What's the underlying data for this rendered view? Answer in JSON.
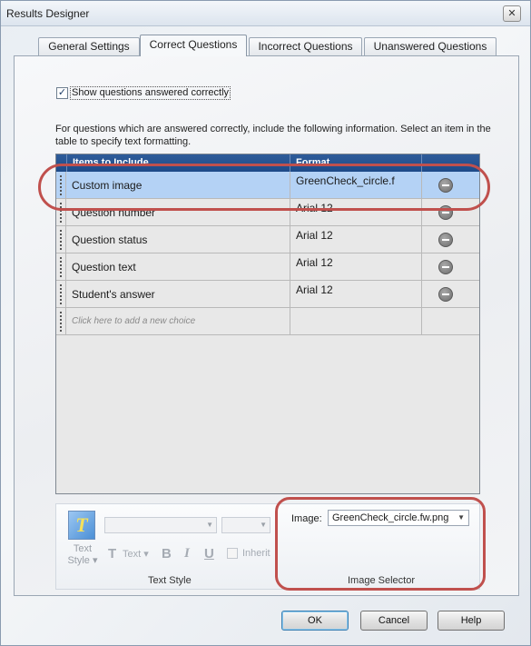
{
  "window": {
    "title": "Results Designer",
    "close_glyph": "✕"
  },
  "tabs": [
    {
      "label": "General Settings"
    },
    {
      "label": "Correct Questions",
      "active": true
    },
    {
      "label": "Incorrect Questions"
    },
    {
      "label": "Unanswered Questions"
    }
  ],
  "show_checkbox": {
    "label": "Show questions answered correctly",
    "checked": true,
    "glyph": "✓"
  },
  "description": "For questions which are answered correctly, include the following information. Select an item in the table to specify text formatting.",
  "table": {
    "headers": [
      "Items to Include",
      "Format"
    ],
    "rows": [
      {
        "item": "Custom image",
        "format": "GreenCheck_circle.f",
        "selected": true
      },
      {
        "item": "Question number",
        "format": "Arial 12"
      },
      {
        "item": "Question status",
        "format": "Arial 12"
      },
      {
        "item": "Question text",
        "format": "Arial 12"
      },
      {
        "item": "Student's answer",
        "format": "Arial 12"
      }
    ],
    "add_row_hint": "Click here to add a new choice"
  },
  "text_style": {
    "icon_letter": "T",
    "label_line1": "Text",
    "label_line2": "Style ▾",
    "text_btn_glyph": "T",
    "text_btn_label": "Text ▾",
    "bold": "B",
    "italic": "I",
    "underline": "U",
    "inherit": "Inherit",
    "group_label": "Text Style"
  },
  "image_selector": {
    "label": "Image:",
    "value": "GreenCheck_circle.fw.png",
    "group_label": "Image Selector"
  },
  "buttons": {
    "ok": "OK",
    "cancel": "Cancel",
    "help": "Help"
  },
  "colors": {
    "header_blue": "#1d4a88",
    "selected_row": "#b4d2f5",
    "annotation_red": "#c0504d"
  },
  "icons": [
    "close-icon",
    "checkbox-checked-icon",
    "drag-grip-icon",
    "remove-circle-icon",
    "text-style-icon",
    "dropdown-arrow-icon"
  ]
}
